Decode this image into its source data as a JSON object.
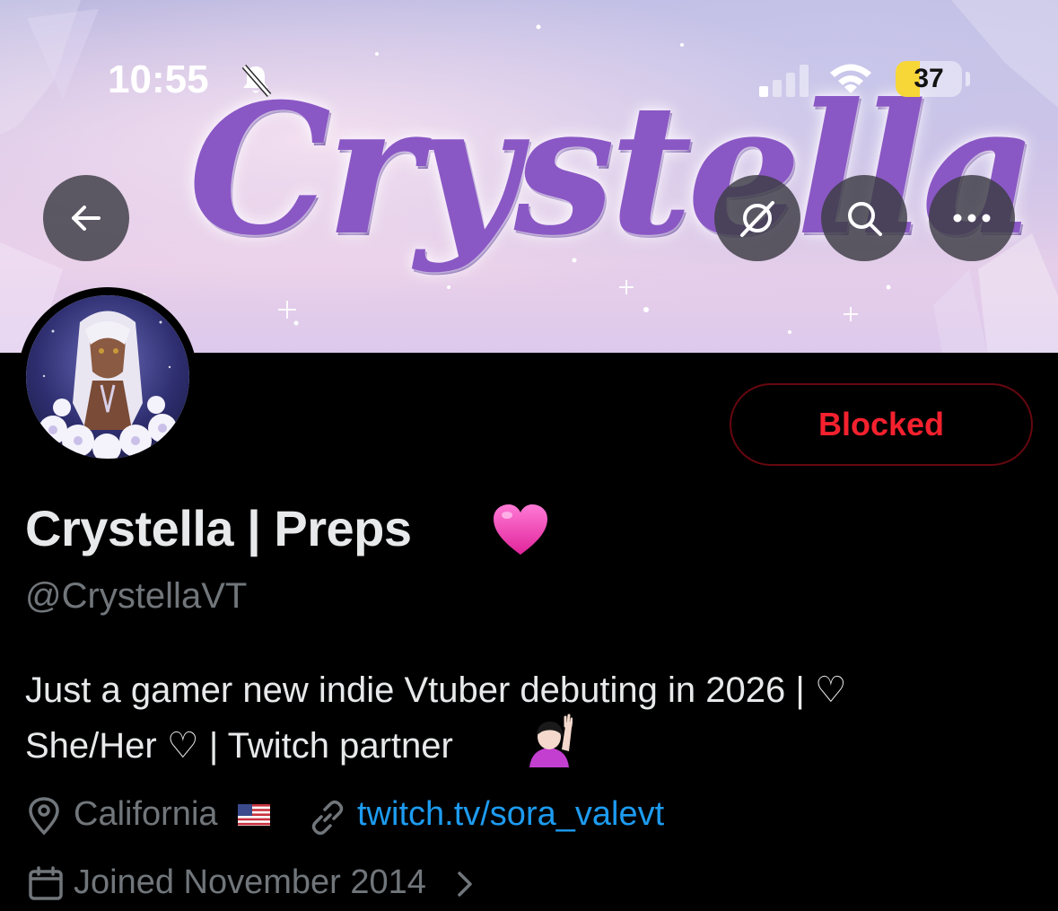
{
  "status_bar": {
    "time": "10:55",
    "battery_level": "37",
    "battery_fraction": 0.37,
    "icons": [
      "bell-slash-icon",
      "cellular-signal-icon",
      "wifi-icon",
      "battery-icon"
    ]
  },
  "banner": {
    "title": "Crystella"
  },
  "header_actions": {
    "back_icon": "arrow-left-icon",
    "grok_icon": "grok-icon",
    "search_icon": "search-icon",
    "more_icon": "more-horizontal-icon"
  },
  "profile": {
    "display_name": "Crystella | Preps",
    "name_emoji": "pink-heart",
    "handle": "@CrystellaVT",
    "follow_button_label": "Blocked",
    "bio_line1": "Just a gamer new indie Vtuber debuting in 2026 | ♡",
    "bio_line2": "She/Her ♡ | Twitch partner",
    "bio_emoji": "person-raising-hand",
    "location": "California",
    "location_flag": "us-flag",
    "website": "twitch.tv/sora_valevt",
    "joined": "Joined November 2014"
  },
  "colors": {
    "background": "#000000",
    "text_primary": "#e7e9ea",
    "text_secondary": "#71767b",
    "link": "#1d9bf0",
    "blocked_red": "#f4212e",
    "blocked_border": "#67070f",
    "banner_purple": "#8a58c4"
  }
}
